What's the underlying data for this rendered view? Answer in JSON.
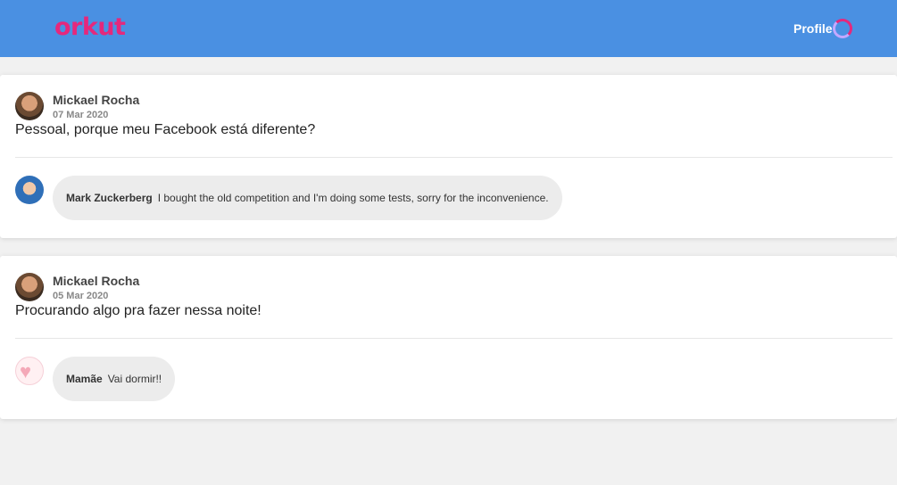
{
  "header": {
    "logo": "orkut",
    "profile_label": "Profile",
    "colors": {
      "bar": "#4a90e2",
      "brand": "#e5287c"
    }
  },
  "posts": [
    {
      "author": "Mickael Rocha",
      "date": "07 Mar 2020",
      "text": "Pessoal, porque meu Facebook está diferente?",
      "comments": [
        {
          "author": "Mark Zuckerberg",
          "text": "I bought the old competition and I'm doing some tests, sorry for the inconvenience."
        }
      ]
    },
    {
      "author": "Mickael Rocha",
      "date": "05 Mar 2020",
      "text": "Procurando algo pra fazer nessa noite!",
      "comments": [
        {
          "author": "Mamãe",
          "text": "Vai dormir!!"
        }
      ]
    }
  ]
}
